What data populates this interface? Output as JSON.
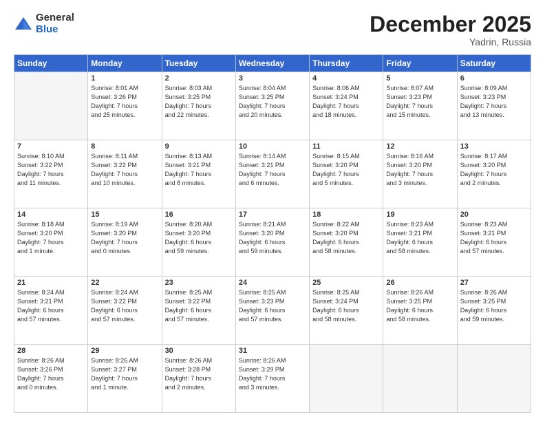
{
  "logo": {
    "general": "General",
    "blue": "Blue"
  },
  "title": "December 2025",
  "location": "Yadrin, Russia",
  "weekdays": [
    "Sunday",
    "Monday",
    "Tuesday",
    "Wednesday",
    "Thursday",
    "Friday",
    "Saturday"
  ],
  "weeks": [
    [
      {
        "day": null,
        "info": null
      },
      {
        "day": "1",
        "info": "Sunrise: 8:01 AM\nSunset: 3:26 PM\nDaylight: 7 hours\nand 25 minutes."
      },
      {
        "day": "2",
        "info": "Sunrise: 8:03 AM\nSunset: 3:25 PM\nDaylight: 7 hours\nand 22 minutes."
      },
      {
        "day": "3",
        "info": "Sunrise: 8:04 AM\nSunset: 3:25 PM\nDaylight: 7 hours\nand 20 minutes."
      },
      {
        "day": "4",
        "info": "Sunrise: 8:06 AM\nSunset: 3:24 PM\nDaylight: 7 hours\nand 18 minutes."
      },
      {
        "day": "5",
        "info": "Sunrise: 8:07 AM\nSunset: 3:23 PM\nDaylight: 7 hours\nand 15 minutes."
      },
      {
        "day": "6",
        "info": "Sunrise: 8:09 AM\nSunset: 3:23 PM\nDaylight: 7 hours\nand 13 minutes."
      }
    ],
    [
      {
        "day": "7",
        "info": "Sunrise: 8:10 AM\nSunset: 3:22 PM\nDaylight: 7 hours\nand 11 minutes."
      },
      {
        "day": "8",
        "info": "Sunrise: 8:11 AM\nSunset: 3:22 PM\nDaylight: 7 hours\nand 10 minutes."
      },
      {
        "day": "9",
        "info": "Sunrise: 8:13 AM\nSunset: 3:21 PM\nDaylight: 7 hours\nand 8 minutes."
      },
      {
        "day": "10",
        "info": "Sunrise: 8:14 AM\nSunset: 3:21 PM\nDaylight: 7 hours\nand 6 minutes."
      },
      {
        "day": "11",
        "info": "Sunrise: 8:15 AM\nSunset: 3:20 PM\nDaylight: 7 hours\nand 5 minutes."
      },
      {
        "day": "12",
        "info": "Sunrise: 8:16 AM\nSunset: 3:20 PM\nDaylight: 7 hours\nand 3 minutes."
      },
      {
        "day": "13",
        "info": "Sunrise: 8:17 AM\nSunset: 3:20 PM\nDaylight: 7 hours\nand 2 minutes."
      }
    ],
    [
      {
        "day": "14",
        "info": "Sunrise: 8:18 AM\nSunset: 3:20 PM\nDaylight: 7 hours\nand 1 minute."
      },
      {
        "day": "15",
        "info": "Sunrise: 8:19 AM\nSunset: 3:20 PM\nDaylight: 7 hours\nand 0 minutes."
      },
      {
        "day": "16",
        "info": "Sunrise: 8:20 AM\nSunset: 3:20 PM\nDaylight: 6 hours\nand 59 minutes."
      },
      {
        "day": "17",
        "info": "Sunrise: 8:21 AM\nSunset: 3:20 PM\nDaylight: 6 hours\nand 59 minutes."
      },
      {
        "day": "18",
        "info": "Sunrise: 8:22 AM\nSunset: 3:20 PM\nDaylight: 6 hours\nand 58 minutes."
      },
      {
        "day": "19",
        "info": "Sunrise: 8:23 AM\nSunset: 3:21 PM\nDaylight: 6 hours\nand 58 minutes."
      },
      {
        "day": "20",
        "info": "Sunrise: 8:23 AM\nSunset: 3:21 PM\nDaylight: 6 hours\nand 57 minutes."
      }
    ],
    [
      {
        "day": "21",
        "info": "Sunrise: 8:24 AM\nSunset: 3:21 PM\nDaylight: 6 hours\nand 57 minutes."
      },
      {
        "day": "22",
        "info": "Sunrise: 8:24 AM\nSunset: 3:22 PM\nDaylight: 6 hours\nand 57 minutes."
      },
      {
        "day": "23",
        "info": "Sunrise: 8:25 AM\nSunset: 3:22 PM\nDaylight: 6 hours\nand 57 minutes."
      },
      {
        "day": "24",
        "info": "Sunrise: 8:25 AM\nSunset: 3:23 PM\nDaylight: 6 hours\nand 57 minutes."
      },
      {
        "day": "25",
        "info": "Sunrise: 8:25 AM\nSunset: 3:24 PM\nDaylight: 6 hours\nand 58 minutes."
      },
      {
        "day": "26",
        "info": "Sunrise: 8:26 AM\nSunset: 3:25 PM\nDaylight: 6 hours\nand 58 minutes."
      },
      {
        "day": "27",
        "info": "Sunrise: 8:26 AM\nSunset: 3:25 PM\nDaylight: 6 hours\nand 59 minutes."
      }
    ],
    [
      {
        "day": "28",
        "info": "Sunrise: 8:26 AM\nSunset: 3:26 PM\nDaylight: 7 hours\nand 0 minutes."
      },
      {
        "day": "29",
        "info": "Sunrise: 8:26 AM\nSunset: 3:27 PM\nDaylight: 7 hours\nand 1 minute."
      },
      {
        "day": "30",
        "info": "Sunrise: 8:26 AM\nSunset: 3:28 PM\nDaylight: 7 hours\nand 2 minutes."
      },
      {
        "day": "31",
        "info": "Sunrise: 8:26 AM\nSunset: 3:29 PM\nDaylight: 7 hours\nand 3 minutes."
      },
      {
        "day": null,
        "info": null
      },
      {
        "day": null,
        "info": null
      },
      {
        "day": null,
        "info": null
      }
    ]
  ]
}
